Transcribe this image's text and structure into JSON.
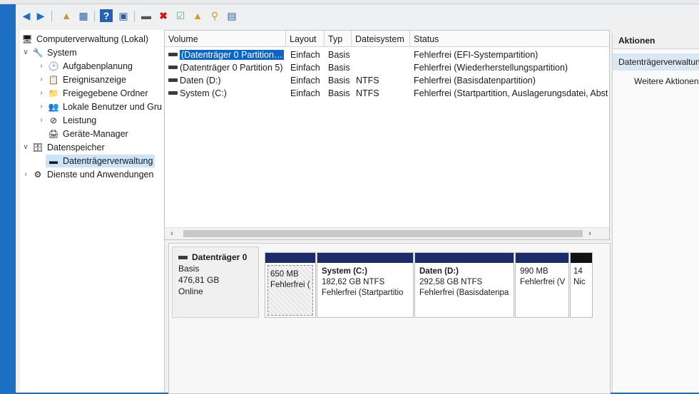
{
  "toolbar": {
    "icons": [
      "back-arrow-icon",
      "forward-arrow-icon",
      "up-folder-icon",
      "show-hide-tree-icon",
      "help-icon",
      "properties-icon",
      "connect-icon",
      "delete-icon",
      "check-icon",
      "new-icon",
      "search-icon",
      "list-icon"
    ]
  },
  "tree": {
    "root": "Computerverwaltung (Lokal)",
    "system": "System",
    "aufgaben": "Aufgabenplanung",
    "ereignis": "Ereignisanzeige",
    "ordner": "Freigegebene Ordner",
    "benutzer": "Lokale Benutzer und Gru",
    "leistung": "Leistung",
    "geraete": "Geräte-Manager",
    "speicher": "Datenspeicher",
    "datentraeger": "Datenträgerverwaltung",
    "dienste": "Dienste und Anwendungen"
  },
  "volumes": {
    "columns": [
      "Volume",
      "Layout",
      "Typ",
      "Dateisystem",
      "Status"
    ],
    "rows": [
      {
        "name": "(Datenträger 0 Partition…",
        "layout": "Einfach",
        "typ": "Basis",
        "fs": "",
        "status": "Fehlerfrei (EFI-Systempartition)"
      },
      {
        "name": "(Datenträger 0 Partition 5)",
        "layout": "Einfach",
        "typ": "Basis",
        "fs": "",
        "status": "Fehlerfrei (Wiederherstellungspartition)"
      },
      {
        "name": "Daten (D:)",
        "layout": "Einfach",
        "typ": "Basis",
        "fs": "NTFS",
        "status": "Fehlerfrei (Basisdatenpartition)"
      },
      {
        "name": "System (C:)",
        "layout": "Einfach",
        "typ": "Basis",
        "fs": "NTFS",
        "status": "Fehlerfrei (Startpartition, Auslagerungsdatei, Abst"
      }
    ]
  },
  "disk": {
    "title": "Datenträger 0",
    "type": "Basis",
    "size": "476,81 GB",
    "state": "Online",
    "partitions": [
      {
        "name": "",
        "size": "650 MB",
        "status": "Fehlerfrei ("
      },
      {
        "name": "System  (C:)",
        "size": "182,62 GB NTFS",
        "status": "Fehlerfrei (Startpartitio"
      },
      {
        "name": "Daten  (D:)",
        "size": "292,58 GB NTFS",
        "status": "Fehlerfrei (Basisdatenpa"
      },
      {
        "name": "",
        "size": "990 MB",
        "status": "Fehlerfrei (V"
      },
      {
        "name": "",
        "size": "14",
        "status": "Nic"
      }
    ]
  },
  "actions": {
    "header": "Aktionen",
    "sub": "Datenträgerverwaltung",
    "more": "Weitere Aktionen"
  },
  "colors": {
    "accent": "#0a64c9",
    "partition_bar": "#1c2c6b",
    "desktop": "#1d6fc4"
  }
}
